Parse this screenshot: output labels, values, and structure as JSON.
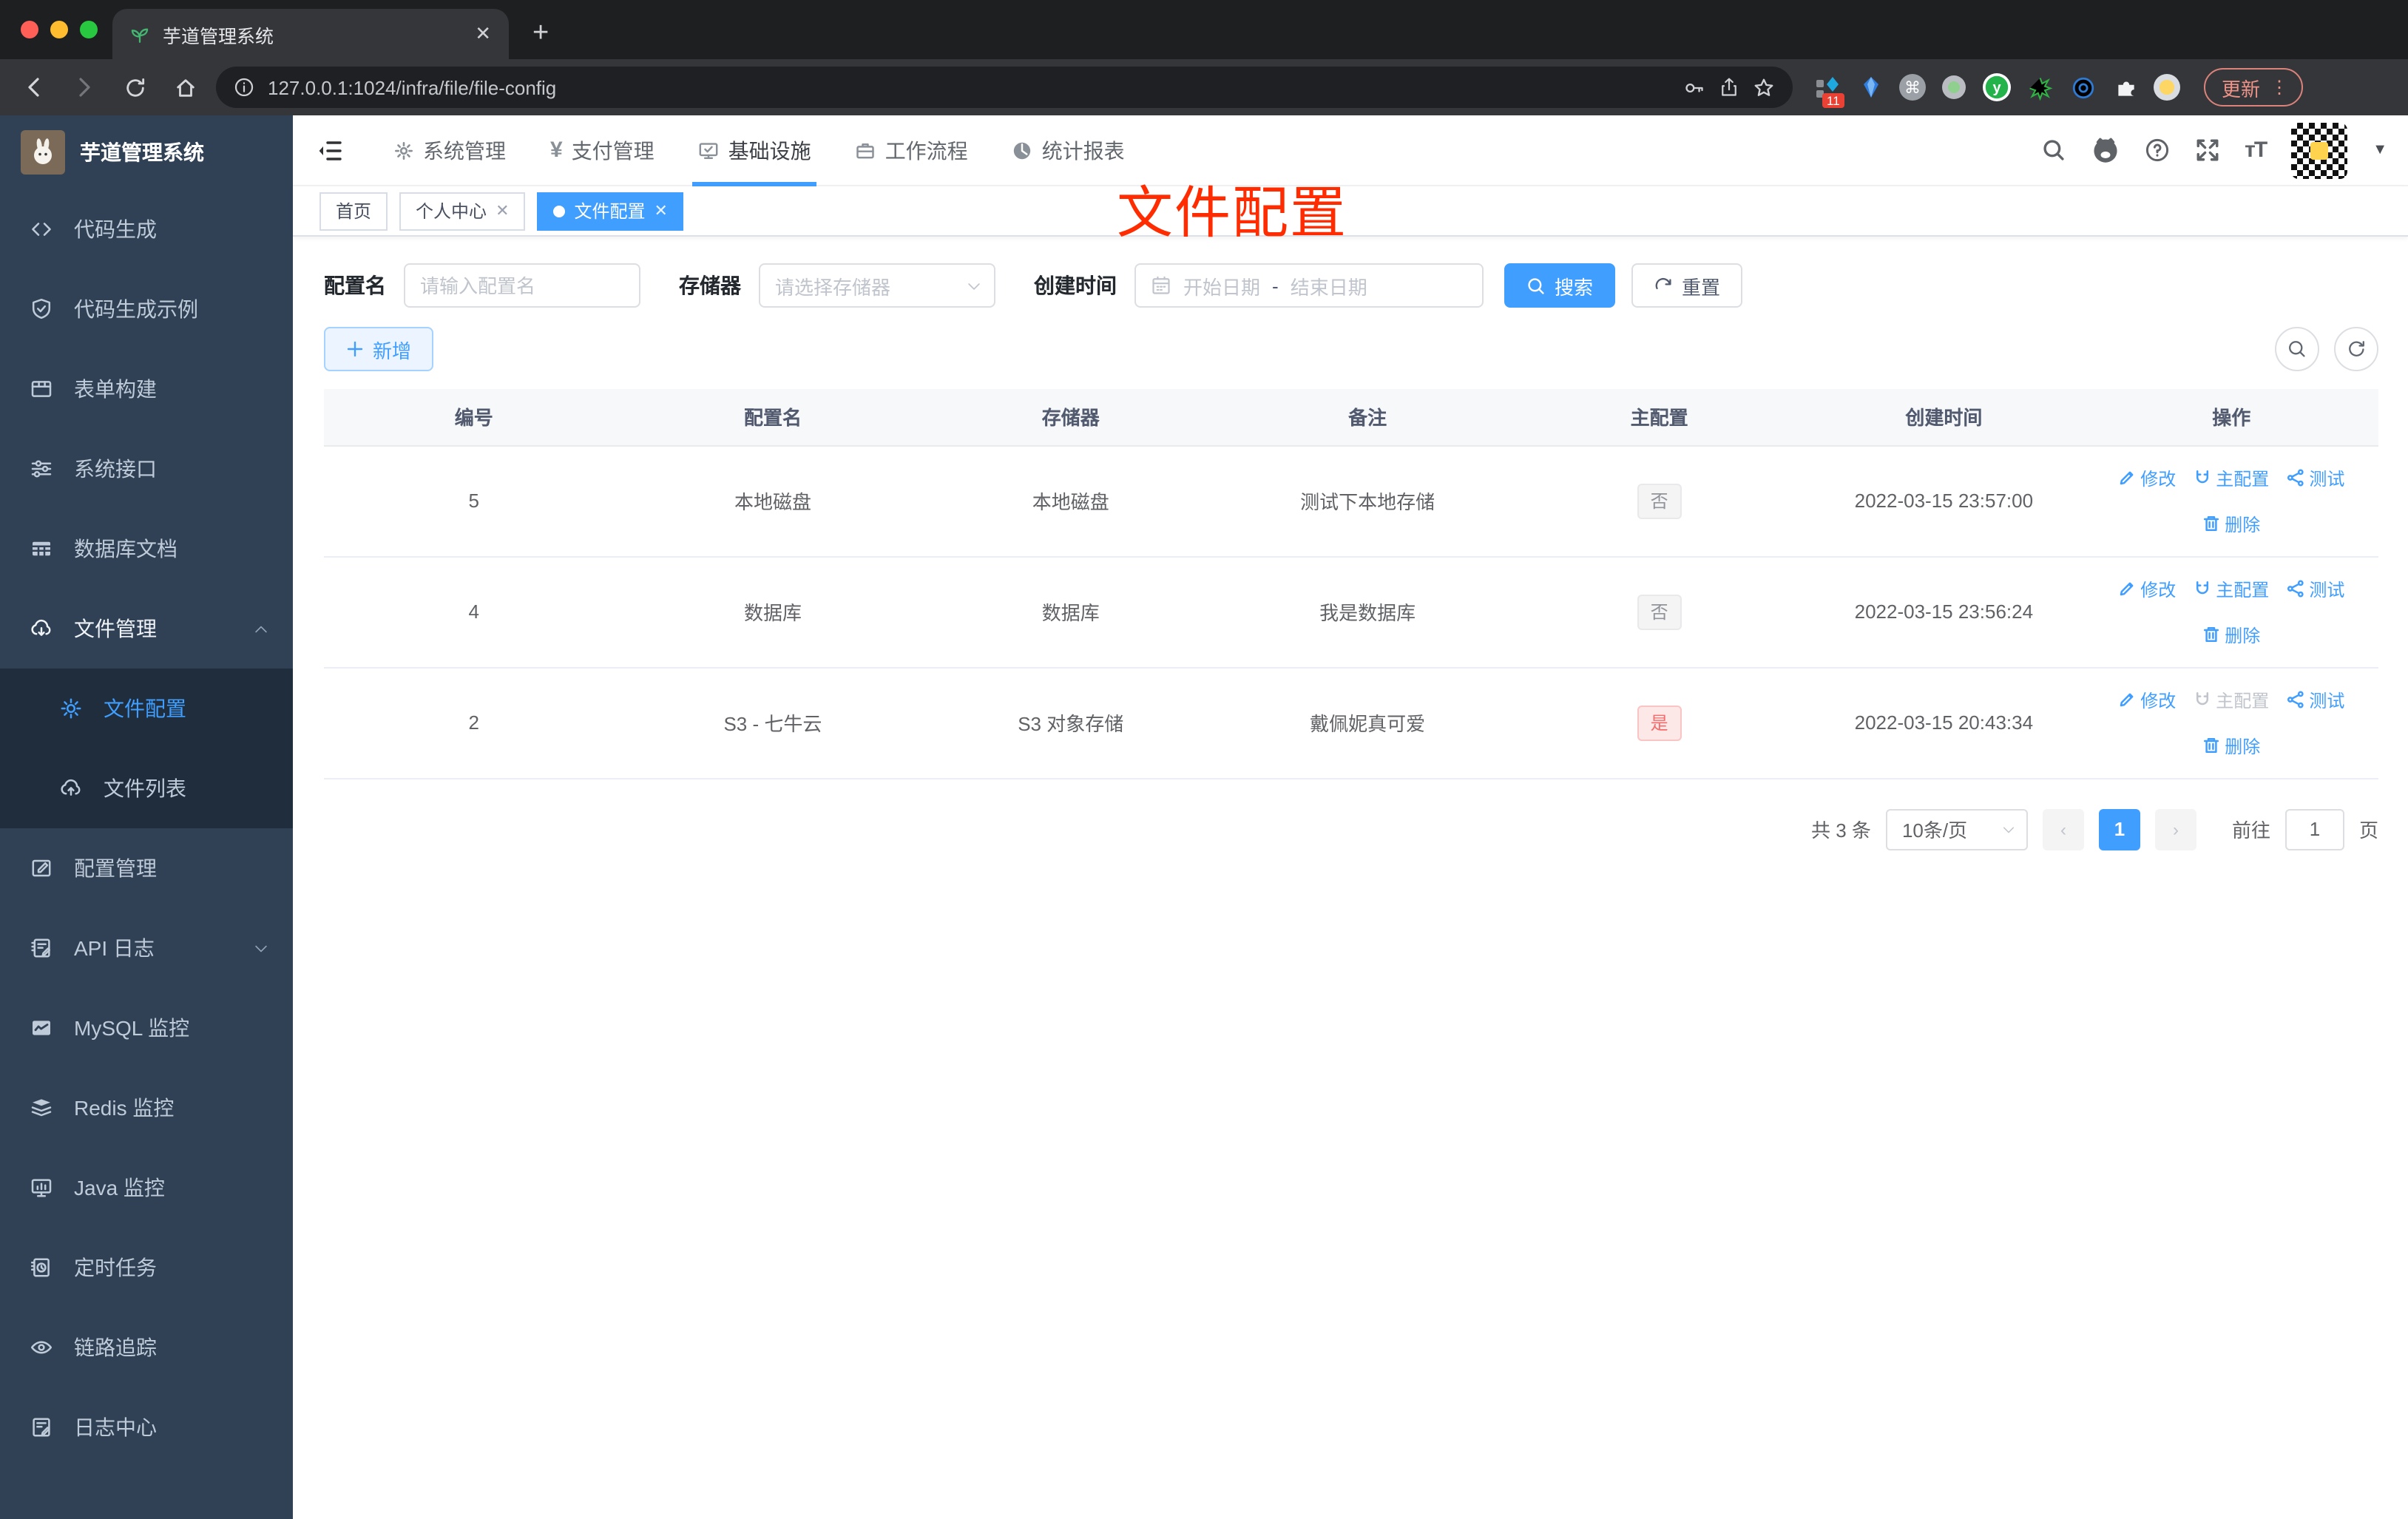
{
  "browser": {
    "tab_title": "芋道管理系统",
    "url": "127.0.0.1:1024/infra/file/file-config",
    "update_label": "更新",
    "extension_badge": "11"
  },
  "app": {
    "logo_title": "芋道管理系统",
    "sidebar": {
      "items": [
        {
          "label": "代码生成"
        },
        {
          "label": "代码生成示例"
        },
        {
          "label": "表单构建"
        },
        {
          "label": "系统接口"
        },
        {
          "label": "数据库文档"
        },
        {
          "label": "文件管理"
        },
        {
          "label": "文件配置"
        },
        {
          "label": "文件列表"
        },
        {
          "label": "配置管理"
        },
        {
          "label": "API 日志"
        },
        {
          "label": "MySQL 监控"
        },
        {
          "label": "Redis 监控"
        },
        {
          "label": "Java 监控"
        },
        {
          "label": "定时任务"
        },
        {
          "label": "链路追踪"
        },
        {
          "label": "日志中心"
        }
      ]
    },
    "topnav": {
      "items": [
        {
          "label": "系统管理"
        },
        {
          "label": "支付管理"
        },
        {
          "label": "基础设施"
        },
        {
          "label": "工作流程"
        },
        {
          "label": "统计报表"
        }
      ]
    },
    "tabs": {
      "items": [
        {
          "label": "首页"
        },
        {
          "label": "个人中心"
        },
        {
          "label": "文件配置"
        }
      ]
    },
    "annotation": {
      "text": "文件配置",
      "color": "#fe2c00"
    },
    "filters": {
      "name_label": "配置名",
      "name_placeholder": "请输入配置名",
      "storage_label": "存储器",
      "storage_placeholder": "请选择存储器",
      "date_label": "创建时间",
      "date_start_placeholder": "开始日期",
      "date_separator": "-",
      "date_end_placeholder": "结束日期",
      "search_label": "搜索",
      "reset_label": "重置"
    },
    "toolbar": {
      "add_label": "新增"
    },
    "table": {
      "columns": [
        "编号",
        "配置名",
        "存储器",
        "备注",
        "主配置",
        "创建时间",
        "操作"
      ],
      "actions": {
        "edit": "修改",
        "master": "主配置",
        "test": "测试",
        "delete": "删除"
      },
      "rows": [
        {
          "id": "5",
          "name": "本地磁盘",
          "storage": "本地磁盘",
          "remark": "测试下本地存储",
          "master": "否",
          "created": "2022-03-15 23:57:00"
        },
        {
          "id": "4",
          "name": "数据库",
          "storage": "数据库",
          "remark": "我是数据库",
          "master": "否",
          "created": "2022-03-15 23:56:24"
        },
        {
          "id": "2",
          "name": "S3 - 七牛云",
          "storage": "S3 对象存储",
          "remark": "戴佩妮真可爱",
          "master": "是",
          "created": "2022-03-15 20:43:34"
        }
      ]
    },
    "pagination": {
      "total": "共 3 条",
      "page_size": "10条/页",
      "current_page": "1",
      "goto_label": "前往",
      "goto_value": "1",
      "unit_label": "页"
    }
  },
  "colors": {
    "primary": "#409eff",
    "danger": "#f56c6c",
    "annotation": "#fe2c00",
    "sidebar_bg": "#304156",
    "submenu_bg": "#1f2d3d"
  }
}
